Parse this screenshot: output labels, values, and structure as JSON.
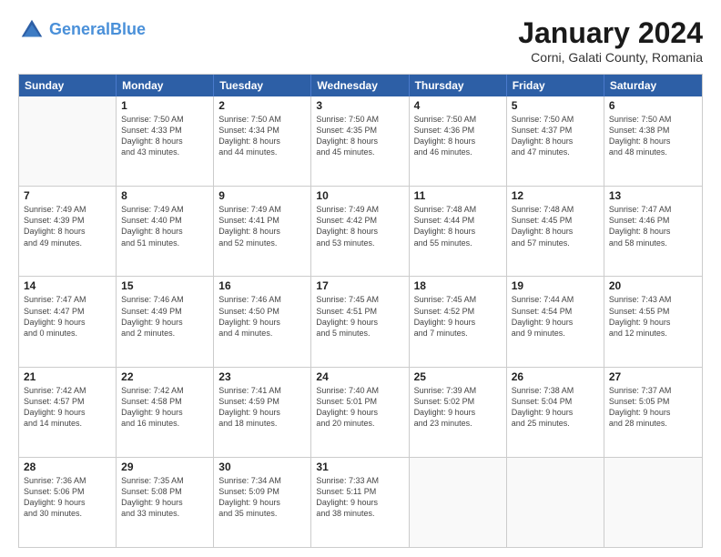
{
  "header": {
    "logo_line1": "General",
    "logo_line2": "Blue",
    "month_title": "January 2024",
    "location": "Corni, Galati County, Romania"
  },
  "weekdays": [
    "Sunday",
    "Monday",
    "Tuesday",
    "Wednesday",
    "Thursday",
    "Friday",
    "Saturday"
  ],
  "rows": [
    [
      {
        "day": "",
        "info": ""
      },
      {
        "day": "1",
        "info": "Sunrise: 7:50 AM\nSunset: 4:33 PM\nDaylight: 8 hours\nand 43 minutes."
      },
      {
        "day": "2",
        "info": "Sunrise: 7:50 AM\nSunset: 4:34 PM\nDaylight: 8 hours\nand 44 minutes."
      },
      {
        "day": "3",
        "info": "Sunrise: 7:50 AM\nSunset: 4:35 PM\nDaylight: 8 hours\nand 45 minutes."
      },
      {
        "day": "4",
        "info": "Sunrise: 7:50 AM\nSunset: 4:36 PM\nDaylight: 8 hours\nand 46 minutes."
      },
      {
        "day": "5",
        "info": "Sunrise: 7:50 AM\nSunset: 4:37 PM\nDaylight: 8 hours\nand 47 minutes."
      },
      {
        "day": "6",
        "info": "Sunrise: 7:50 AM\nSunset: 4:38 PM\nDaylight: 8 hours\nand 48 minutes."
      }
    ],
    [
      {
        "day": "7",
        "info": "Sunrise: 7:49 AM\nSunset: 4:39 PM\nDaylight: 8 hours\nand 49 minutes."
      },
      {
        "day": "8",
        "info": "Sunrise: 7:49 AM\nSunset: 4:40 PM\nDaylight: 8 hours\nand 51 minutes."
      },
      {
        "day": "9",
        "info": "Sunrise: 7:49 AM\nSunset: 4:41 PM\nDaylight: 8 hours\nand 52 minutes."
      },
      {
        "day": "10",
        "info": "Sunrise: 7:49 AM\nSunset: 4:42 PM\nDaylight: 8 hours\nand 53 minutes."
      },
      {
        "day": "11",
        "info": "Sunrise: 7:48 AM\nSunset: 4:44 PM\nDaylight: 8 hours\nand 55 minutes."
      },
      {
        "day": "12",
        "info": "Sunrise: 7:48 AM\nSunset: 4:45 PM\nDaylight: 8 hours\nand 57 minutes."
      },
      {
        "day": "13",
        "info": "Sunrise: 7:47 AM\nSunset: 4:46 PM\nDaylight: 8 hours\nand 58 minutes."
      }
    ],
    [
      {
        "day": "14",
        "info": "Sunrise: 7:47 AM\nSunset: 4:47 PM\nDaylight: 9 hours\nand 0 minutes."
      },
      {
        "day": "15",
        "info": "Sunrise: 7:46 AM\nSunset: 4:49 PM\nDaylight: 9 hours\nand 2 minutes."
      },
      {
        "day": "16",
        "info": "Sunrise: 7:46 AM\nSunset: 4:50 PM\nDaylight: 9 hours\nand 4 minutes."
      },
      {
        "day": "17",
        "info": "Sunrise: 7:45 AM\nSunset: 4:51 PM\nDaylight: 9 hours\nand 5 minutes."
      },
      {
        "day": "18",
        "info": "Sunrise: 7:45 AM\nSunset: 4:52 PM\nDaylight: 9 hours\nand 7 minutes."
      },
      {
        "day": "19",
        "info": "Sunrise: 7:44 AM\nSunset: 4:54 PM\nDaylight: 9 hours\nand 9 minutes."
      },
      {
        "day": "20",
        "info": "Sunrise: 7:43 AM\nSunset: 4:55 PM\nDaylight: 9 hours\nand 12 minutes."
      }
    ],
    [
      {
        "day": "21",
        "info": "Sunrise: 7:42 AM\nSunset: 4:57 PM\nDaylight: 9 hours\nand 14 minutes."
      },
      {
        "day": "22",
        "info": "Sunrise: 7:42 AM\nSunset: 4:58 PM\nDaylight: 9 hours\nand 16 minutes."
      },
      {
        "day": "23",
        "info": "Sunrise: 7:41 AM\nSunset: 4:59 PM\nDaylight: 9 hours\nand 18 minutes."
      },
      {
        "day": "24",
        "info": "Sunrise: 7:40 AM\nSunset: 5:01 PM\nDaylight: 9 hours\nand 20 minutes."
      },
      {
        "day": "25",
        "info": "Sunrise: 7:39 AM\nSunset: 5:02 PM\nDaylight: 9 hours\nand 23 minutes."
      },
      {
        "day": "26",
        "info": "Sunrise: 7:38 AM\nSunset: 5:04 PM\nDaylight: 9 hours\nand 25 minutes."
      },
      {
        "day": "27",
        "info": "Sunrise: 7:37 AM\nSunset: 5:05 PM\nDaylight: 9 hours\nand 28 minutes."
      }
    ],
    [
      {
        "day": "28",
        "info": "Sunrise: 7:36 AM\nSunset: 5:06 PM\nDaylight: 9 hours\nand 30 minutes."
      },
      {
        "day": "29",
        "info": "Sunrise: 7:35 AM\nSunset: 5:08 PM\nDaylight: 9 hours\nand 33 minutes."
      },
      {
        "day": "30",
        "info": "Sunrise: 7:34 AM\nSunset: 5:09 PM\nDaylight: 9 hours\nand 35 minutes."
      },
      {
        "day": "31",
        "info": "Sunrise: 7:33 AM\nSunset: 5:11 PM\nDaylight: 9 hours\nand 38 minutes."
      },
      {
        "day": "",
        "info": ""
      },
      {
        "day": "",
        "info": ""
      },
      {
        "day": "",
        "info": ""
      }
    ]
  ]
}
